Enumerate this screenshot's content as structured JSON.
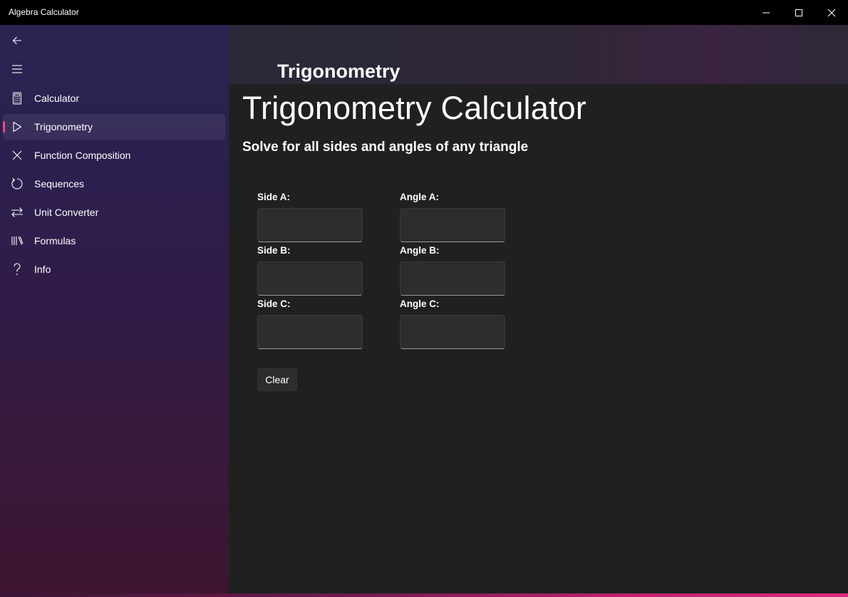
{
  "window": {
    "title": "Algebra Calculator",
    "controls": {
      "minimize": "minimize-icon",
      "maximize": "maximize-icon",
      "close": "close-icon"
    }
  },
  "sidebar": {
    "back_icon": "back-arrow-icon",
    "menu_icon": "hamburger-icon",
    "items": [
      {
        "label": "Calculator",
        "icon": "calculator-icon",
        "selected": false
      },
      {
        "label": "Trigonometry",
        "icon": "triangle-play-icon",
        "selected": true
      },
      {
        "label": "Function Composition",
        "icon": "x-icon",
        "selected": false
      },
      {
        "label": "Sequences",
        "icon": "refresh-icon",
        "selected": false
      },
      {
        "label": "Unit Converter",
        "icon": "swap-arrows-icon",
        "selected": false
      },
      {
        "label": "Formulas",
        "icon": "library-icon",
        "selected": false
      },
      {
        "label": "Info",
        "icon": "question-icon",
        "selected": false
      }
    ],
    "selection_color": "#e74b7c"
  },
  "header": {
    "title": "Trigonometry"
  },
  "main": {
    "heading": "Trigonometry Calculator",
    "subtitle": "Solve for all sides and angles of any triangle",
    "fields": {
      "side_a": {
        "label": "Side A:",
        "value": ""
      },
      "side_b": {
        "label": "Side B:",
        "value": ""
      },
      "side_c": {
        "label": "Side C:",
        "value": ""
      },
      "angle_a": {
        "label": "Angle A:",
        "value": ""
      },
      "angle_b": {
        "label": "Angle B:",
        "value": ""
      },
      "angle_c": {
        "label": "Angle C:",
        "value": ""
      }
    },
    "clear_label": "Clear"
  },
  "colors": {
    "content_bg": "#202020",
    "accent": "#e0287a"
  }
}
